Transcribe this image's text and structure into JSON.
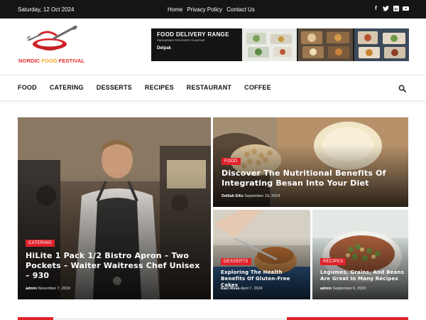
{
  "topbar": {
    "date": "Saturday, 12 Oct 2024",
    "links": [
      "Home",
      "Privacy Policy",
      "Contact Us"
    ],
    "social_icons": [
      "facebook-icon",
      "twitter-icon",
      "linkedin-icon",
      "youtube-icon"
    ]
  },
  "logo": {
    "word1": "NORDIC",
    "word2": "FOOD",
    "word3": "FESTIVAL"
  },
  "banner": {
    "title": "FOOD DELIVERY RANGE",
    "subtitle": "PACKAGING FOR EVERY FLAVOUR",
    "brand": "Detpak"
  },
  "nav": {
    "items": [
      "FOOD",
      "CATERING",
      "DESSERTS",
      "RECIPES",
      "RESTAURANT",
      "COFFEE"
    ],
    "search_icon": "search-icon"
  },
  "posts": [
    {
      "category": "CATERING",
      "title": "HiLite 1 Pack 1/2 Bistro Apron – Two Pockets – Waiter Waitress Chef Unisex – 930",
      "author": "admin",
      "date": "November 7, 2019"
    },
    {
      "category": "FOOD",
      "title": "Discover The Nutritional Benefits Of Integrating Besan Into Your Diet",
      "author": "Delilah Ellis",
      "date": "September 19, 2024"
    },
    {
      "category": "DESSERTS",
      "title": "Exploring The Health Benefits Of Gluten-Free Cakes",
      "author": "Kaci Ross",
      "date": "April 7, 2024"
    },
    {
      "category": "RECIPES",
      "title": "Legumes, Grains, And Beans Are Great In Many Recipes",
      "author": "admin",
      "date": "September 6, 2020"
    }
  ],
  "colors": {
    "accent": "#e0232b",
    "topbar": "#151515"
  }
}
